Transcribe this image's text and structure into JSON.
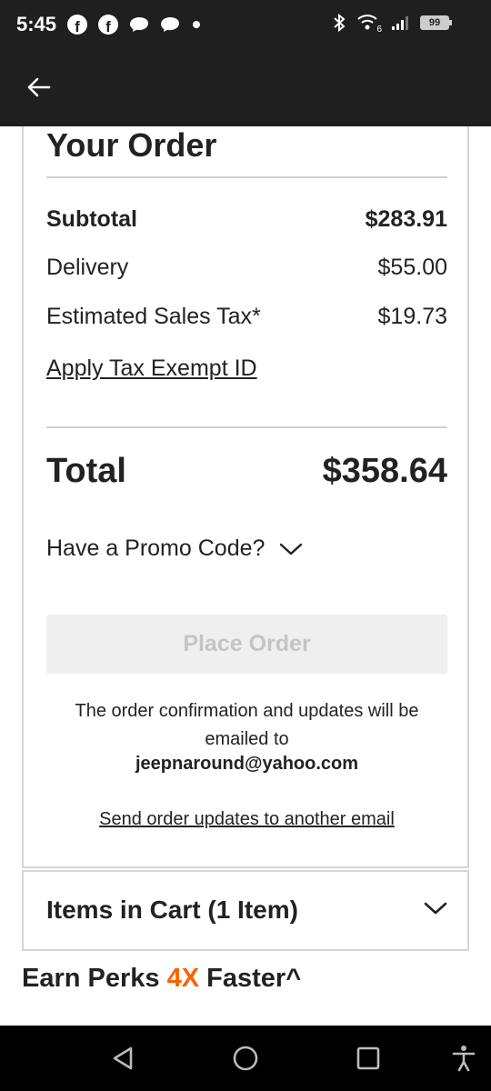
{
  "status_bar": {
    "time": "5:45",
    "left_icons": [
      "facebook-icon",
      "facebook-icon",
      "chat-icon",
      "chat-icon",
      "dot-icon"
    ],
    "right_icons": [
      "bluetooth-icon",
      "wifi-icon",
      "signal-icon",
      "battery-icon"
    ],
    "wifi_label": "6",
    "battery": "99"
  },
  "app_bar": {
    "back_icon": "arrow-left-icon"
  },
  "order": {
    "title": "Your Order",
    "subtotal_label": "Subtotal",
    "subtotal_value": "$283.91",
    "delivery_label": "Delivery",
    "delivery_value": "$55.00",
    "tax_label": "Estimated Sales Tax*",
    "tax_value": "$19.73",
    "tax_exempt_link": "Apply Tax Exempt ID",
    "total_label": "Total",
    "total_value": "$358.64",
    "promo_label": "Have a Promo Code?",
    "place_order_label": "Place Order",
    "confirmation_text": "The order confirmation and updates will be emailed to",
    "email": "jeepnaround@yahoo.com",
    "send_updates_link": "Send order updates to another email"
  },
  "cart": {
    "label": "Items in Cart (1 Item)"
  },
  "perks": {
    "prefix": "Earn Perks",
    "highlight": "4X",
    "suffix": "Faster^"
  },
  "colors": {
    "accent": "#f96302",
    "app_bar": "#1f1f1f",
    "disabled_button": "#efefef"
  },
  "nav_bar": {
    "icons": [
      "back-triangle-icon",
      "home-circle-icon",
      "recents-square-icon",
      "accessibility-icon"
    ]
  }
}
